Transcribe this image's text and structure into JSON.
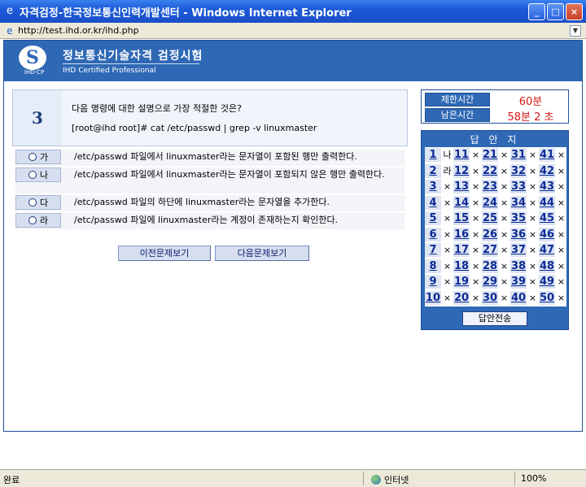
{
  "window": {
    "title": "자격검정-한국정보통신인력개발센터 - Windows Internet Explorer",
    "url": "http://test.ihd.or.kr/ihd.php",
    "minimize_glyph": "_",
    "maximize_glyph": "□",
    "close_glyph": "×"
  },
  "header": {
    "logo_glyph": "S",
    "logo_text": "IHD-CP",
    "title": "정보통신기술자격 검정시험",
    "subtitle": "IHD Certified Professional"
  },
  "question": {
    "number": "3",
    "text": "다음 명령에 대한 설명으로 가장 적절한 것은?",
    "command": "[root@ihd root]# cat /etc/passwd | grep -v linuxmaster"
  },
  "options": [
    {
      "label": "가",
      "text": "/etc/passwd 파일에서 linuxmaster라는 문자열이 포함된 행만 출력한다."
    },
    {
      "label": "나",
      "text": "/etc/passwd 파일에서 linuxmaster라는 문자열이 포함되지 않은 행만 출력한다."
    },
    {
      "label": "다",
      "text": "/etc/passwd 파일의 하단에 linuxmaster라는 문자열을 추가한다."
    },
    {
      "label": "라",
      "text": "/etc/passwd 파일에 linuxmaster라는 계정이 존재하는지 확인한다."
    }
  ],
  "nav": {
    "prev_label": "이전문제보기",
    "next_label": "다음문제보기"
  },
  "timer": {
    "limit_label": "제한시간",
    "limit_value": "60분",
    "remain_label": "남은시간",
    "remain_value": "58분 2 초"
  },
  "answer_sheet": {
    "title": "답 안 지",
    "submit_label": "답안전송",
    "items": [
      {
        "n": "1",
        "a": "나"
      },
      {
        "n": "2",
        "a": "라"
      },
      {
        "n": "3",
        "a": "×"
      },
      {
        "n": "4",
        "a": "×"
      },
      {
        "n": "5",
        "a": "×"
      },
      {
        "n": "6",
        "a": "×"
      },
      {
        "n": "7",
        "a": "×"
      },
      {
        "n": "8",
        "a": "×"
      },
      {
        "n": "9",
        "a": "×"
      },
      {
        "n": "10",
        "a": "×"
      },
      {
        "n": "11",
        "a": "×"
      },
      {
        "n": "12",
        "a": "×"
      },
      {
        "n": "13",
        "a": "×"
      },
      {
        "n": "14",
        "a": "×"
      },
      {
        "n": "15",
        "a": "×"
      },
      {
        "n": "16",
        "a": "×"
      },
      {
        "n": "17",
        "a": "×"
      },
      {
        "n": "18",
        "a": "×"
      },
      {
        "n": "19",
        "a": "×"
      },
      {
        "n": "20",
        "a": "×"
      },
      {
        "n": "21",
        "a": "×"
      },
      {
        "n": "22",
        "a": "×"
      },
      {
        "n": "23",
        "a": "×"
      },
      {
        "n": "24",
        "a": "×"
      },
      {
        "n": "25",
        "a": "×"
      },
      {
        "n": "26",
        "a": "×"
      },
      {
        "n": "27",
        "a": "×"
      },
      {
        "n": "28",
        "a": "×"
      },
      {
        "n": "29",
        "a": "×"
      },
      {
        "n": "30",
        "a": "×"
      },
      {
        "n": "31",
        "a": "×"
      },
      {
        "n": "32",
        "a": "×"
      },
      {
        "n": "33",
        "a": "×"
      },
      {
        "n": "34",
        "a": "×"
      },
      {
        "n": "35",
        "a": "×"
      },
      {
        "n": "36",
        "a": "×"
      },
      {
        "n": "37",
        "a": "×"
      },
      {
        "n": "38",
        "a": "×"
      },
      {
        "n": "39",
        "a": "×"
      },
      {
        "n": "40",
        "a": "×"
      },
      {
        "n": "41",
        "a": "×"
      },
      {
        "n": "42",
        "a": "×"
      },
      {
        "n": "43",
        "a": "×"
      },
      {
        "n": "44",
        "a": "×"
      },
      {
        "n": "45",
        "a": "×"
      },
      {
        "n": "46",
        "a": "×"
      },
      {
        "n": "47",
        "a": "×"
      },
      {
        "n": "48",
        "a": "×"
      },
      {
        "n": "49",
        "a": "×"
      },
      {
        "n": "50",
        "a": "×"
      }
    ]
  },
  "status": {
    "left": "완료",
    "zone": "인터넷",
    "zoom": "100%"
  },
  "colors": {
    "brand_blue": "#2f68b5",
    "timer_red": "#d41818"
  }
}
